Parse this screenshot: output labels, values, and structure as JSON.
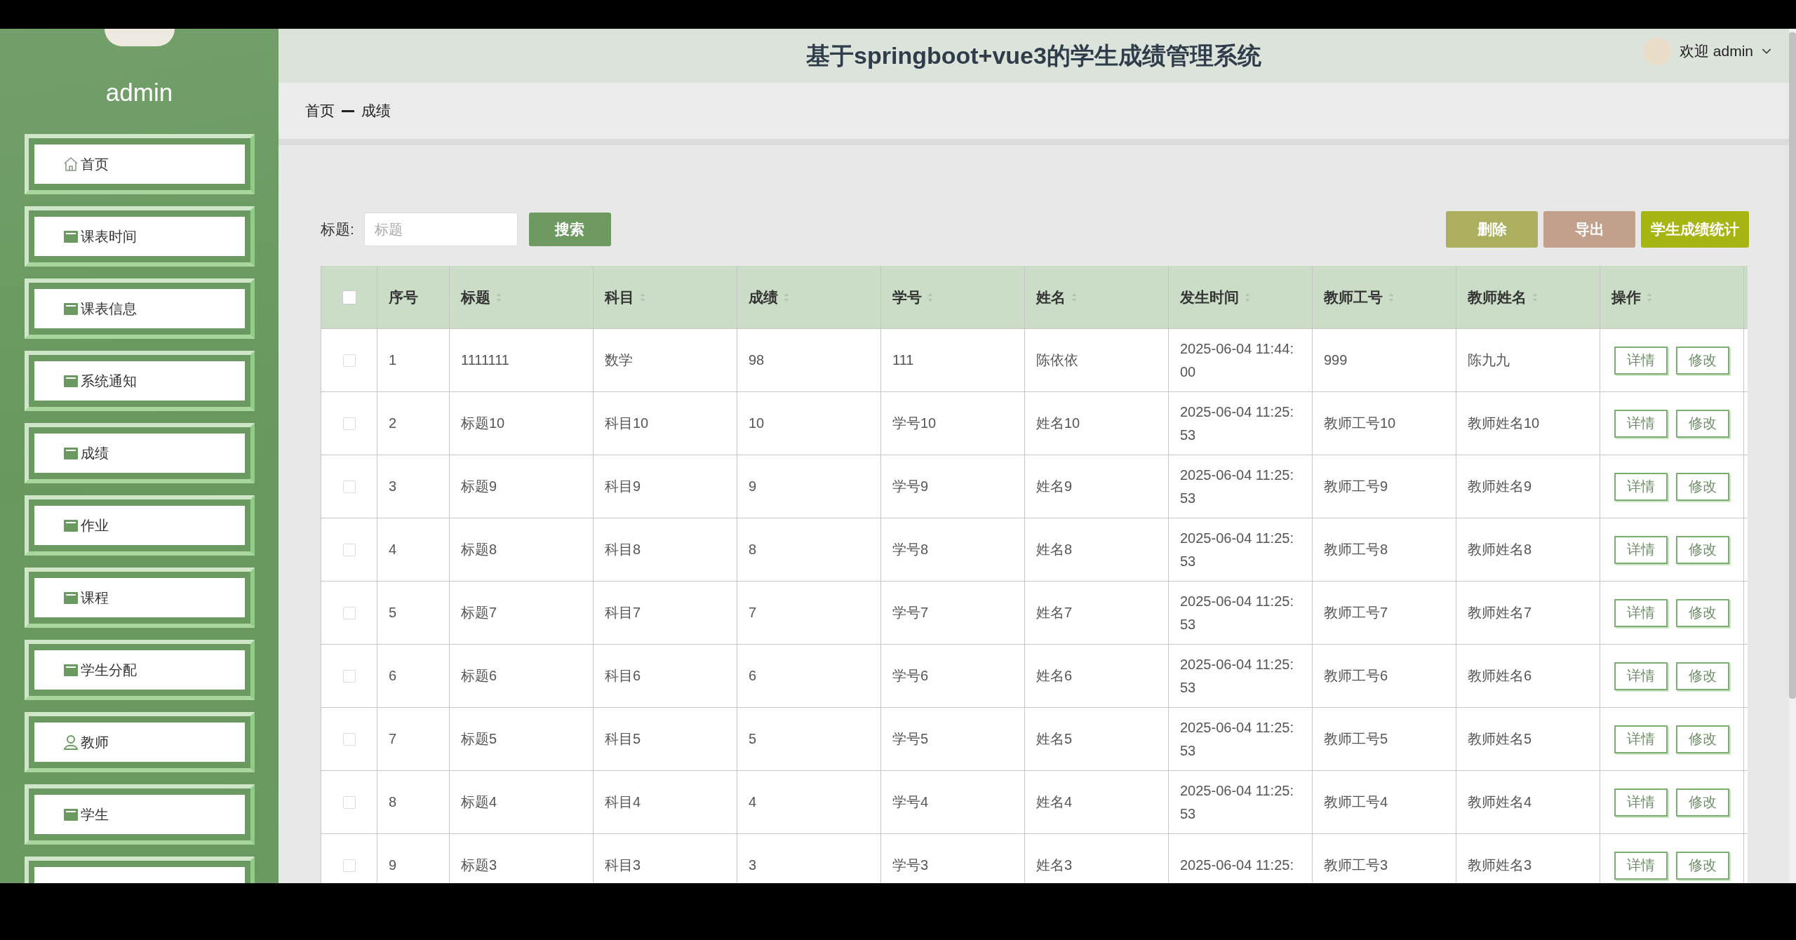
{
  "sidebar": {
    "user": "admin",
    "items": [
      {
        "label": "首页"
      },
      {
        "label": "课表时间"
      },
      {
        "label": "课表信息"
      },
      {
        "label": "系统通知"
      },
      {
        "label": "成绩"
      },
      {
        "label": "作业"
      },
      {
        "label": "课程"
      },
      {
        "label": "学生分配"
      },
      {
        "label": "教师"
      },
      {
        "label": "学生"
      }
    ]
  },
  "header": {
    "title": "基于springboot+vue3的学生成绩管理系统",
    "welcome": "欢迎 admin"
  },
  "breadcrumb": [
    "首页",
    "成绩"
  ],
  "search": {
    "label": "标题:",
    "placeholder": "标题",
    "button": "搜索"
  },
  "actions": [
    {
      "label": "删除",
      "color": "#abaf5e"
    },
    {
      "label": "导出",
      "color": "#c2a08c"
    },
    {
      "label": "学生成绩统计",
      "color": "#a6b512"
    }
  ],
  "table": {
    "header_checkbox": {
      "checked": false
    },
    "columns": [
      {
        "label": "序号",
        "sortable": false
      },
      {
        "label": "标题",
        "sortable": true
      },
      {
        "label": "科目",
        "sortable": true
      },
      {
        "label": "成绩",
        "sortable": true
      },
      {
        "label": "学号",
        "sortable": true
      },
      {
        "label": "姓名",
        "sortable": true
      },
      {
        "label": "发生时间",
        "sortable": true
      },
      {
        "label": "教师工号",
        "sortable": true
      },
      {
        "label": "教师姓名",
        "sortable": true
      },
      {
        "label": "操作",
        "sortable": true
      }
    ],
    "rows": [
      {
        "selected": false,
        "cells": [
          "1",
          "1111111",
          "数学",
          "98",
          "111",
          "陈依依",
          "2025-06-04 11:44:00",
          "999",
          "陈九九"
        ],
        "buttons": [
          "详情",
          "修改"
        ]
      },
      {
        "selected": false,
        "cells": [
          "2",
          "标题10",
          "科目10",
          "10",
          "学号10",
          "姓名10",
          "2025-06-04 11:25:53",
          "教师工号10",
          "教师姓名10"
        ],
        "buttons": [
          "详情",
          "修改"
        ]
      },
      {
        "selected": false,
        "cells": [
          "3",
          "标题9",
          "科目9",
          "9",
          "学号9",
          "姓名9",
          "2025-06-04 11:25:53",
          "教师工号9",
          "教师姓名9"
        ],
        "buttons": [
          "详情",
          "修改"
        ]
      },
      {
        "selected": false,
        "cells": [
          "4",
          "标题8",
          "科目8",
          "8",
          "学号8",
          "姓名8",
          "2025-06-04 11:25:53",
          "教师工号8",
          "教师姓名8"
        ],
        "buttons": [
          "详情",
          "修改"
        ]
      },
      {
        "selected": false,
        "cells": [
          "5",
          "标题7",
          "科目7",
          "7",
          "学号7",
          "姓名7",
          "2025-06-04 11:25:53",
          "教师工号7",
          "教师姓名7"
        ],
        "buttons": [
          "详情",
          "修改"
        ]
      },
      {
        "selected": false,
        "cells": [
          "6",
          "标题6",
          "科目6",
          "6",
          "学号6",
          "姓名6",
          "2025-06-04 11:25:53",
          "教师工号6",
          "教师姓名6"
        ],
        "buttons": [
          "详情",
          "修改"
        ]
      },
      {
        "selected": false,
        "cells": [
          "7",
          "标题5",
          "科目5",
          "5",
          "学号5",
          "姓名5",
          "2025-06-04 11:25:53",
          "教师工号5",
          "教师姓名5"
        ],
        "buttons": [
          "详情",
          "修改"
        ]
      },
      {
        "selected": false,
        "cells": [
          "8",
          "标题4",
          "科目4",
          "4",
          "学号4",
          "姓名4",
          "2025-06-04 11:25:53",
          "教师工号4",
          "教师姓名4"
        ],
        "buttons": [
          "详情",
          "修改"
        ]
      },
      {
        "selected": false,
        "cells": [
          "9",
          "标题3",
          "科目3",
          "3",
          "学号3",
          "姓名3",
          "2025-06-04 11:25:",
          "教师工号3",
          "教师姓名3"
        ],
        "buttons": [
          "详情",
          "修改"
        ]
      }
    ]
  }
}
